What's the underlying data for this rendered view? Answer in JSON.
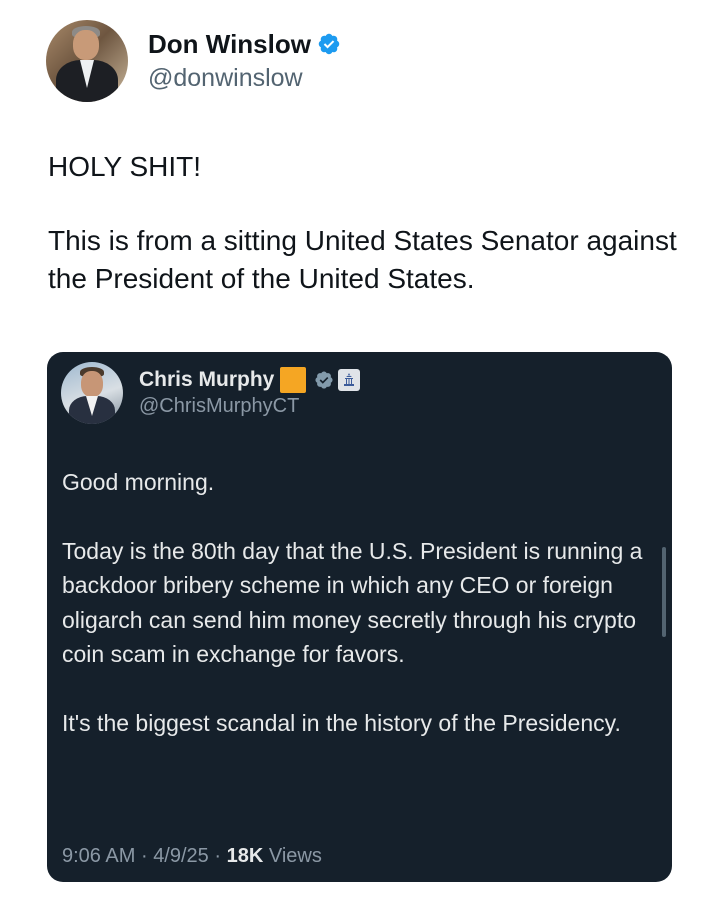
{
  "author": {
    "display_name": "Don Winslow",
    "handle": "@donwinslow",
    "verified": true,
    "verified_color": "#1d9bf0"
  },
  "tweet": {
    "paragraphs": [
      "HOLY SHIT!",
      "This is from a sitting United States Senator against the President of the United States."
    ]
  },
  "quoted_tweet": {
    "display_name": "Chris Murphy",
    "handle": "@ChrisMurphyCT",
    "badges": [
      "orange-square",
      "gray-verified-icon",
      "capitol-icon"
    ],
    "paragraphs": [
      "Good morning.",
      "Today is the 80th day that the U.S. President is running a backdoor bribery scheme in which any CEO or foreign oligarch can send him money secretly through his crypto coin scam in exchange for favors.",
      "It's the biggest scandal in the history of the Presidency."
    ],
    "time": "9:06 AM",
    "date": "4/9/25",
    "views_count": "18K",
    "views_label": "Views",
    "separator": "·"
  },
  "colors": {
    "quote_background": "#15202b",
    "orange_badge": "#f5a623"
  }
}
